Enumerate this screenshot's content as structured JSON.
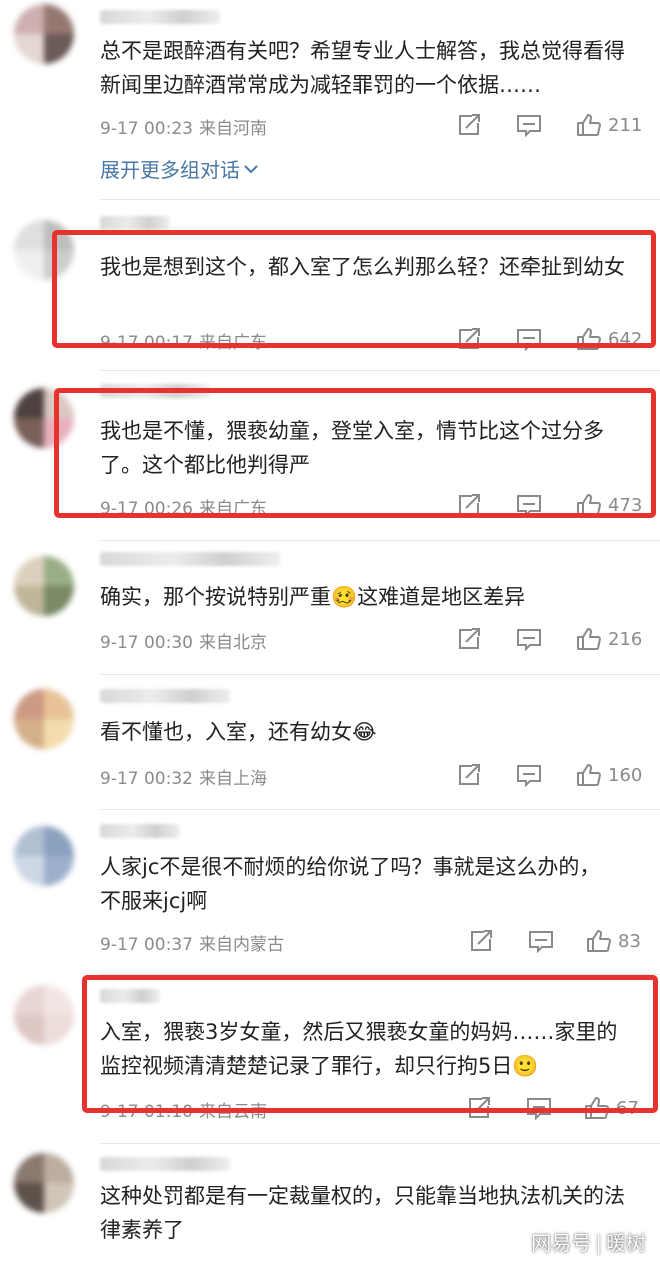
{
  "comments": [
    {
      "text": "总不是跟醉酒有关吧？希望专业人士解答，我总觉得看得新闻里边醉酒常常成为减轻罪罚的一个依据……",
      "time": "9-17 00:23",
      "source": "来自河南",
      "likes": "211",
      "avatar_colors": [
        "#c9a8a8",
        "#8b6a63",
        "#e3d3cf",
        "#5b4946"
      ]
    },
    {
      "text": "我也是想到这个，都入室了怎么判那么轻？还牵扯到幼女",
      "time": "9-17 00:17",
      "source": "来自广东",
      "likes": "642",
      "avatar_colors": [
        "#dcdcdc",
        "#b7b7b7",
        "#eeeeee",
        "#c8c8c8"
      ]
    },
    {
      "text": "我也是不懂，猥亵幼童，登堂入室，情节比这个过分多了。这个都比他判得严",
      "time": "9-17 00:26",
      "source": "来自广东",
      "likes": "473",
      "avatar_colors": [
        "#3a2e2b",
        "#d7c4bd",
        "#6b4f48",
        "#e7a9b8"
      ]
    },
    {
      "text": "确实，那个按说特别严重🥴这难道是地区差异",
      "time": "9-17 00:30",
      "source": "来自北京",
      "likes": "216",
      "avatar_colors": [
        "#d7ccb6",
        "#8fa579",
        "#b9ae8e",
        "#6b7e55"
      ]
    },
    {
      "text": "看不懂也，入室，还有幼女😂",
      "time": "9-17 00:32",
      "source": "来自上海",
      "likes": "160",
      "avatar_colors": [
        "#c98f78",
        "#e7bd8c",
        "#d0a87e",
        "#f2d9a5"
      ]
    },
    {
      "text": "人家jc不是很不耐烦的给你说了吗？事就是这么办的，不服来jcj啊",
      "time": "9-17 00:37",
      "source": "来自内蒙古",
      "likes": "83",
      "avatar_colors": [
        "#a9b9cf",
        "#7f98b8",
        "#c8d4e2",
        "#93a8c6"
      ]
    },
    {
      "text": "入室，猥亵3岁女童，然后又猥亵女童的妈妈……家里的监控视频清清楚楚记录了罪行，却只行拘5日🙂",
      "time": "9-17 01:10",
      "source": "来自云南",
      "likes": "67",
      "avatar_colors": [
        "#e6d2cf",
        "#f0e3e0",
        "#d9c1bd",
        "#eadad6"
      ]
    },
    {
      "text": "这种处罚都是有一定裁量权的，只能靠当地执法机关的法律素养了",
      "time": "",
      "source": "",
      "likes": "",
      "avatar_colors": [
        "#7d6b5f",
        "#b5a596",
        "#4d4038",
        "#cbbfb1"
      ]
    }
  ],
  "expand_label": "展开更多组对话",
  "highlight_color": "#e8322e",
  "link_color": "#4a78a6",
  "watermark": {
    "brand": "网易号",
    "separator": "|",
    "author": "暖树"
  },
  "icons": {
    "share": "share-icon",
    "comment": "comment-icon",
    "like": "thumbs-up-icon",
    "chevron": "chevron-down-icon"
  }
}
